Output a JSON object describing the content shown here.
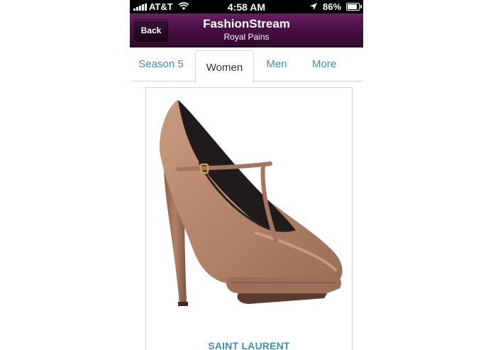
{
  "status_bar": {
    "carrier": "AT&T",
    "time": "4:58 AM",
    "battery": "86%",
    "battery_level": 0.86
  },
  "nav": {
    "back_label": "Back",
    "title": "FashionStream",
    "subtitle": "Royal Pains"
  },
  "tabs": [
    {
      "label": "Season 5",
      "active": false
    },
    {
      "label": "Women",
      "active": true
    },
    {
      "label": "Men",
      "active": false
    },
    {
      "label": "More",
      "active": false
    }
  ],
  "product": {
    "brand": "SAINT LAURENT",
    "image": "shoe-image"
  },
  "colors": {
    "nav_bar": "#4a0f45",
    "accent": "#3d8ecb",
    "shoe": "#b8876a"
  }
}
